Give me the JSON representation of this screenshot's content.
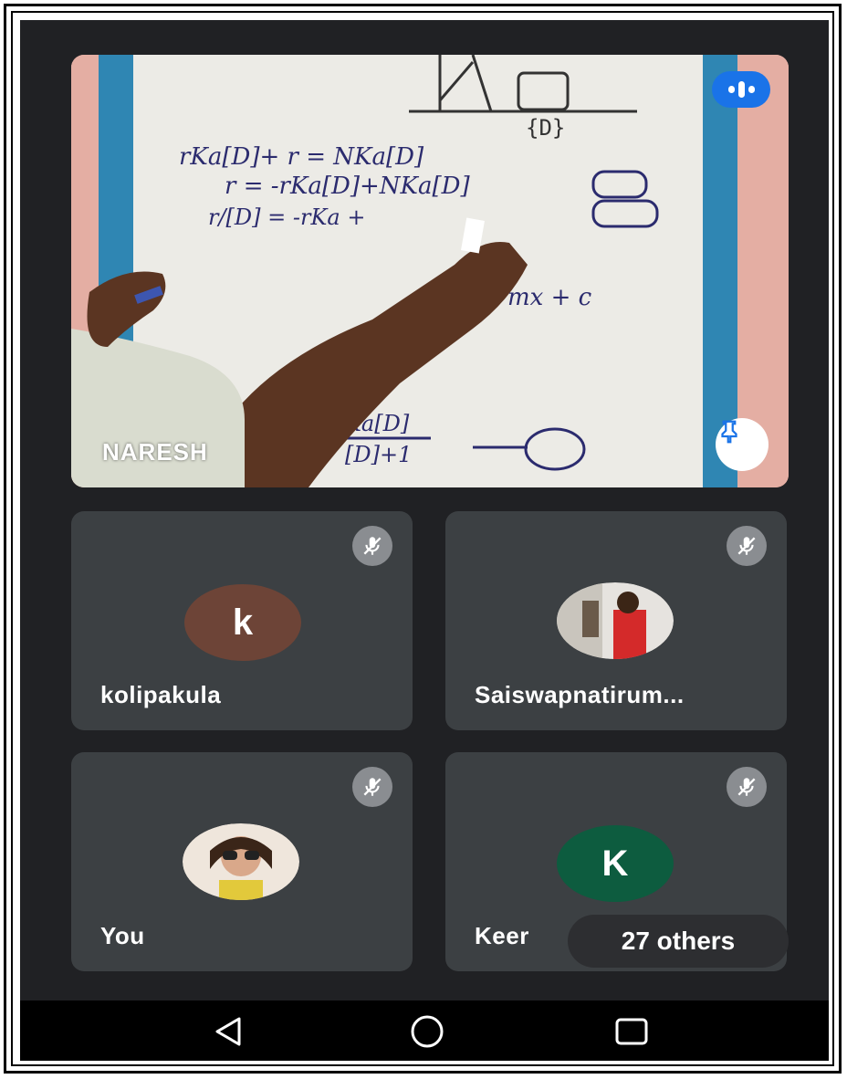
{
  "main_tile": {
    "presenter_name": "NARESH"
  },
  "participants": [
    {
      "name": "kolipakula",
      "avatar_letter": "k",
      "avatar_color": "#6d4437",
      "muted": true
    },
    {
      "name": "Saiswapnatirum...",
      "avatar_letter": "",
      "avatar_color": "#e8e8e8",
      "muted": true
    },
    {
      "name": "You",
      "avatar_letter": "",
      "avatar_color": "#e8e8e8",
      "muted": true
    },
    {
      "name": "Keer",
      "avatar_letter": "K",
      "avatar_color": "#0d5c3f",
      "muted": true
    }
  ],
  "others_chip": {
    "label": "27 others"
  },
  "nav": {
    "back": "back-icon",
    "home": "home-icon",
    "recents": "recents-icon"
  },
  "colors": {
    "background": "#202124",
    "tile": "#3c4043",
    "accent": "#1a73e8"
  }
}
